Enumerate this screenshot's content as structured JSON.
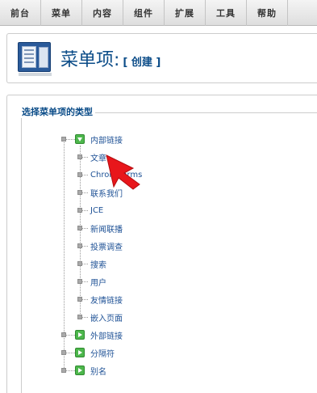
{
  "menubar": {
    "items": [
      "前台",
      "菜单",
      "内容",
      "组件",
      "扩展",
      "工具",
      "帮助"
    ]
  },
  "header": {
    "title": "菜单项:",
    "subtitle": "[ 创建 ]"
  },
  "section": {
    "legend": "选择菜单项的类型"
  },
  "tree": {
    "internal_links": {
      "label": "内部链接",
      "children": [
        "文章",
        "Chronoforms",
        "联系我们",
        "JCE",
        "新闻联播",
        "投票调查",
        "搜索",
        "用户",
        "友情链接",
        "嵌入页面"
      ]
    },
    "external_links": {
      "label": "外部链接"
    },
    "separator": {
      "label": "分隔符"
    },
    "alias": {
      "label": "别名"
    }
  },
  "colors": {
    "accent": "#0b4c88",
    "link": "#1f5296",
    "pointer": "#e8161b",
    "folder": "#4db74c"
  }
}
